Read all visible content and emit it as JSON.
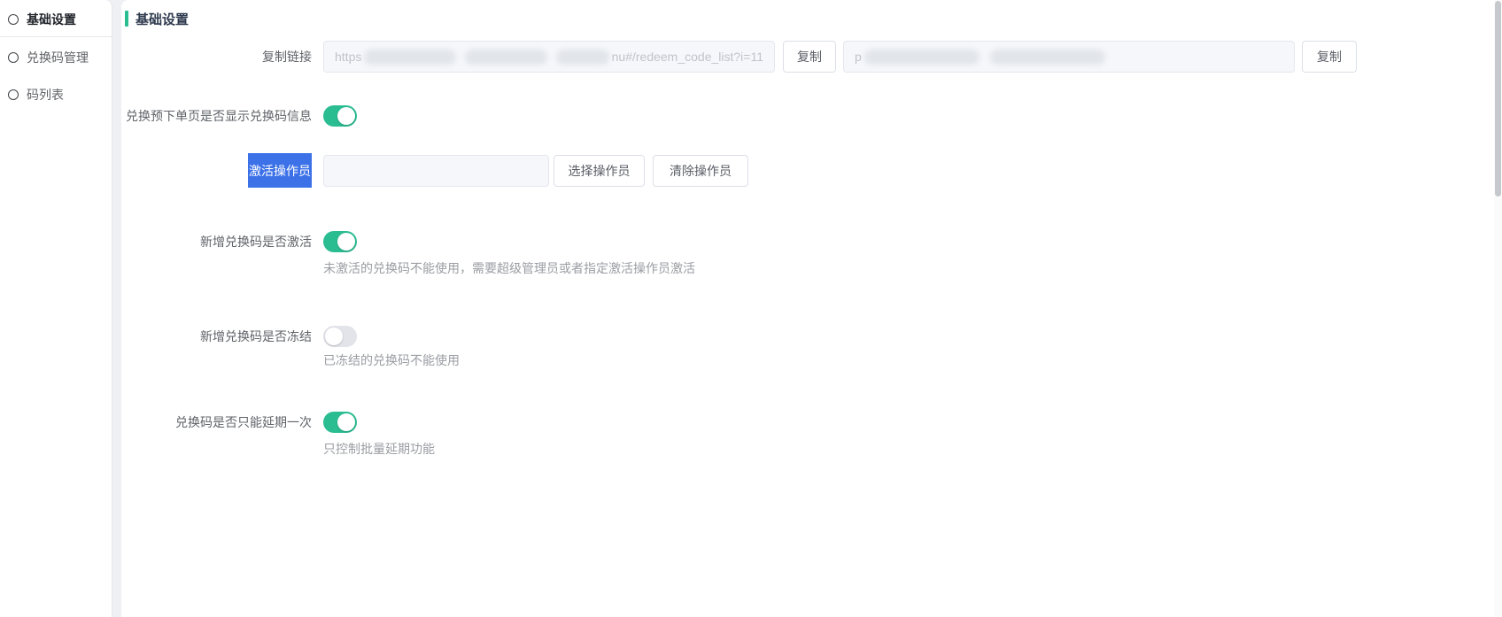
{
  "colors": {
    "accent": "#2bbd92",
    "selection": "#3c71e8",
    "scrollthumb": "#c5c8cc"
  },
  "sidebar": {
    "items": [
      {
        "label": "基础设置",
        "active": true
      },
      {
        "label": "兑换码管理",
        "active": false
      },
      {
        "label": "码列表",
        "active": false
      }
    ]
  },
  "header": {
    "title": "基础设置"
  },
  "form": {
    "copy_link": {
      "label": "复制链接",
      "input1_prefix": "https",
      "input1_suffix": "nu#/redeem_code_list?i=11",
      "copy_button1": "复制",
      "input2_prefix": "p",
      "copy_button2": "复制"
    },
    "show_code_info": {
      "label": "兑换预下单页是否显示兑换码信息",
      "state": "on"
    },
    "activation_operator": {
      "label": "激活操作员",
      "input_value": "",
      "select_button": "选择操作员",
      "clear_button": "清除操作员"
    },
    "new_code_activated": {
      "label": "新增兑换码是否激活",
      "state": "on",
      "hint": "未激活的兑换码不能使用，需要超级管理员或者指定激活操作员激活"
    },
    "new_code_frozen": {
      "label": "新增兑换码是否冻结",
      "state": "off",
      "hint": "已冻结的兑换码不能使用"
    },
    "extend_once": {
      "label": "兑换码是否只能延期一次",
      "state": "on",
      "hint": "只控制批量延期功能"
    }
  }
}
